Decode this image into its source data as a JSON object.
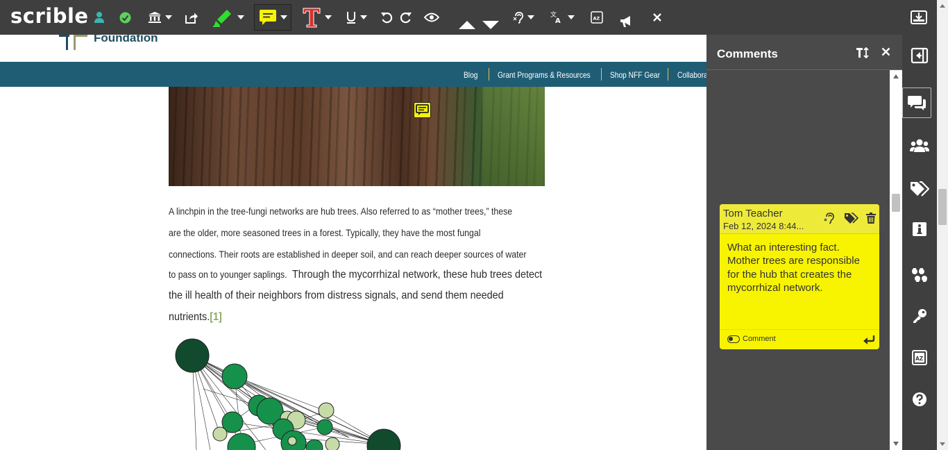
{
  "toolbar": {
    "logo": "scrible",
    "icons": [
      "user-icon",
      "check-icon",
      "library-icon",
      "share-icon",
      "highlighter-icon",
      "comment-icon",
      "text-color-icon",
      "underline-icon",
      "undo-icon",
      "redo-icon",
      "eye-icon",
      "arrow-up-icon",
      "arrow-down-icon",
      "listen-icon",
      "translate-icon",
      "dictionary-icon",
      "announcement-icon",
      "close-icon",
      "save-icon"
    ],
    "colors": {
      "bar": "#3f3f3f",
      "highlight": "#2fdc2f",
      "comment": "#f5f10a",
      "text_color": "#d63030"
    }
  },
  "site": {
    "logo_text": "Foundation",
    "nav_links": [
      "Blog",
      "Grant Programs & Resources",
      "Shop NFF Gear",
      "Collabora"
    ],
    "colors": {
      "nav_bg": "#1f5d75",
      "separator": "#e9c14a",
      "ref_link": "#8aaa63"
    }
  },
  "article": {
    "lines_small": [
      "A linchpin in the tree-fungi networks are hub trees. Also referred to as “mother trees,” these",
      "are the older, more seasoned trees in a forest. Typically, they have the most fungal",
      "connections. Their roots are established in deeper soil, and can reach deeper sources of water",
      "to pass on to younger saplings."
    ],
    "line4_large": " Through the mycorrhizal network, these hub trees detect",
    "line5": "the ill health of their neighbors from distress signals, and send them needed",
    "line6": "nutrients.",
    "reference": "[1]"
  },
  "comments_panel": {
    "title": "Comments",
    "comment": {
      "author": "Tom Teacher",
      "date": "Feb 12, 2024 8:44...",
      "body": "What an interesting fact. Mother trees are responsible for the hub that creates the mycorrhizal network.",
      "footer_label": "Comment",
      "color": "#f8f400"
    }
  },
  "side_bar": {
    "icons": [
      "collapse-panel-icon",
      "comments-icon",
      "users-icon",
      "tags-icon",
      "info-icon",
      "quote-icon",
      "key-icon",
      "dictionary-icon",
      "help-icon"
    ]
  }
}
